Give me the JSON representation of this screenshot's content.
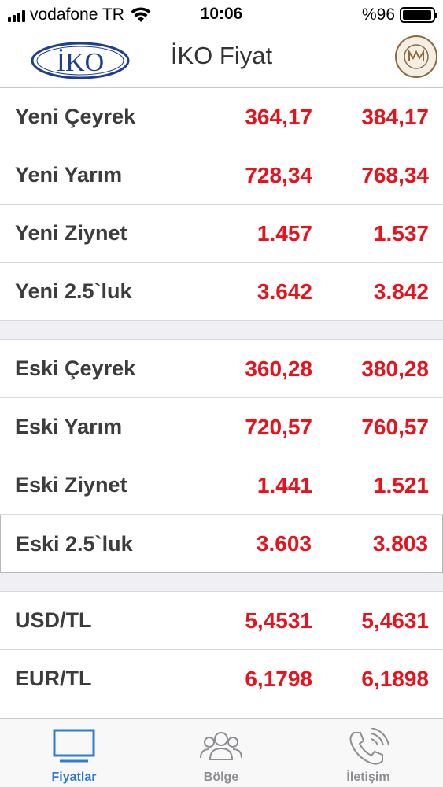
{
  "status_bar": {
    "carrier": "vodafone TR",
    "time": "10:06",
    "battery_percent": "%96",
    "battery_level": 0.96
  },
  "nav_bar": {
    "title": "İKO Fiyat",
    "left_logo": {
      "text": "İKO",
      "icon": "iko-logo"
    },
    "right_logo": {
      "icon": "nadir-metal-rafineri-logo"
    }
  },
  "sections": [
    {
      "rows": [
        {
          "label": "Yeni Çeyrek",
          "buy": "364,17",
          "sell": "384,17"
        },
        {
          "label": "Yeni Yarım",
          "buy": "728,34",
          "sell": "768,34"
        },
        {
          "label": "Yeni Ziynet",
          "buy": "1.457",
          "sell": "1.537"
        },
        {
          "label": "Yeni 2.5`luk",
          "buy": "3.642",
          "sell": "3.842"
        }
      ]
    },
    {
      "rows": [
        {
          "label": "Eski Çeyrek",
          "buy": "360,28",
          "sell": "380,28"
        },
        {
          "label": "Eski Yarım",
          "buy": "720,57",
          "sell": "760,57"
        },
        {
          "label": "Eski Ziynet",
          "buy": "1.441",
          "sell": "1.521"
        },
        {
          "label": "Eski 2.5`luk",
          "buy": "3.603",
          "sell": "3.803"
        }
      ]
    },
    {
      "rows": [
        {
          "label": "USD/TL",
          "buy": "5,4531",
          "sell": "5,4631"
        },
        {
          "label": "EUR/TL",
          "buy": "6,1798",
          "sell": "6,1898"
        }
      ]
    }
  ],
  "tab_bar": {
    "tabs": [
      {
        "label": "Fiyatlar",
        "icon": "monitor-icon",
        "active": true
      },
      {
        "label": "Bölge",
        "icon": "people-icon",
        "active": false
      },
      {
        "label": "İletişim",
        "icon": "phone-icon",
        "active": false
      }
    ]
  },
  "colors": {
    "price": "#e8121c",
    "active_tab": "#2f7bd6",
    "inactive_tab": "#8e8e93",
    "separator": "#efeff4"
  }
}
